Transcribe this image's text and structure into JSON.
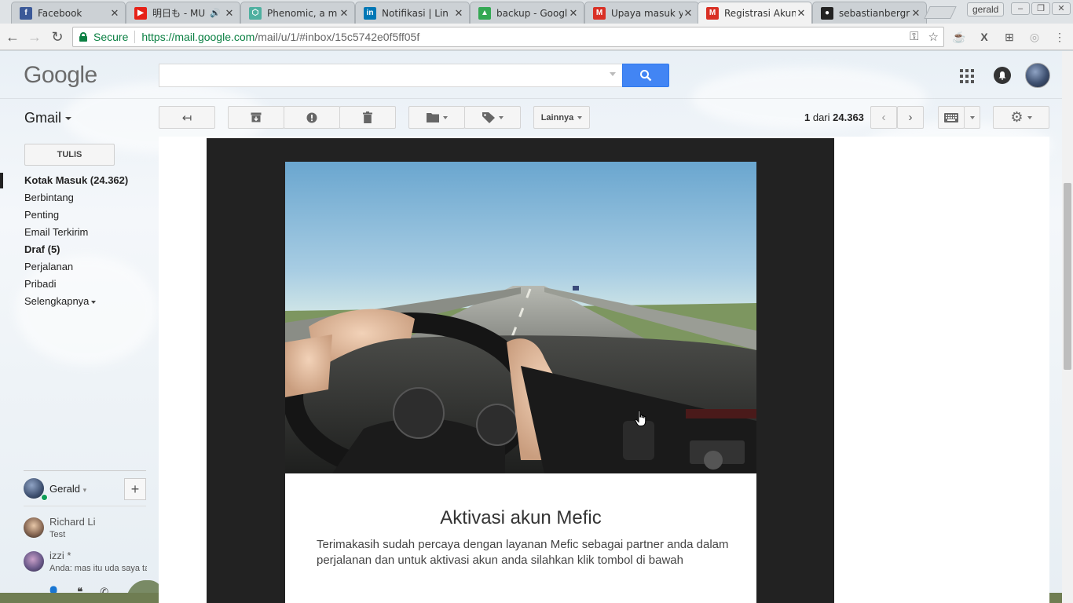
{
  "browser": {
    "tabs": [
      {
        "title": "Facebook",
        "favicon": "facebook-icon",
        "color": "#3b5998",
        "glyph": "f",
        "active": false
      },
      {
        "title": "明日も - MU",
        "favicon": "youtube-icon",
        "color": "#e62117",
        "glyph": "▶",
        "active": false,
        "audio": true
      },
      {
        "title": "Phenomic, a m",
        "favicon": "phenomic-icon",
        "color": "#4fb0a0",
        "glyph": "⬡",
        "active": false
      },
      {
        "title": "Notifikasi | Lin",
        "favicon": "linkedin-icon",
        "color": "#0077b5",
        "glyph": "in",
        "active": false
      },
      {
        "title": "backup - Googl",
        "favicon": "google-drive-icon",
        "color": "#34a853",
        "glyph": "▲",
        "active": false
      },
      {
        "title": "Upaya masuk y",
        "favicon": "gmail-icon",
        "color": "#d93025",
        "glyph": "M",
        "active": false
      },
      {
        "title": "Registrasi Akun",
        "favicon": "gmail-icon",
        "color": "#d93025",
        "glyph": "M",
        "active": true
      },
      {
        "title": "sebastianbergr",
        "favicon": "github-icon",
        "color": "#222222",
        "glyph": "●",
        "active": false
      }
    ],
    "profile_name": "gerald",
    "secure_label": "Secure",
    "url_host": "https://mail.google.com",
    "url_rest": "/mail/u/1/#inbox/15c5742e0f5ff05f"
  },
  "gmail": {
    "logo": "Google",
    "search_placeholder": "",
    "app_label": "Gmail",
    "more_label": "Lainnya",
    "page_count_current": "1",
    "page_count_sep": " dari ",
    "page_count_total": "24.363",
    "compose_label": "TULIS",
    "nav": [
      {
        "label": "Kotak Masuk (24.362)",
        "bold": true,
        "active": true
      },
      {
        "label": "Berbintang",
        "bold": false
      },
      {
        "label": "Penting",
        "bold": false
      },
      {
        "label": "Email Terkirim",
        "bold": false
      },
      {
        "label": "Draf (5)",
        "bold": true
      },
      {
        "label": "Perjalanan",
        "bold": false
      },
      {
        "label": "Pribadi",
        "bold": false
      }
    ],
    "nav_more": "Selengkapnya",
    "hangouts": {
      "me": "Gerald",
      "contacts": [
        {
          "name": "Richard Li",
          "status": "Test"
        },
        {
          "name": "izzi *",
          "status": "Anda: mas itu uda saya ta"
        }
      ]
    }
  },
  "email": {
    "title": "Aktivasi akun Mefic",
    "body": "Terimakasih sudah percaya dengan layanan Mefic sebagai partner anda dalam perjalanan dan untuk aktivasi akun anda silahkan klik tombol di bawah"
  },
  "colors": {
    "search_button": "#4285f4",
    "secure_green": "#0b8043",
    "frame_dark": "#222222"
  }
}
